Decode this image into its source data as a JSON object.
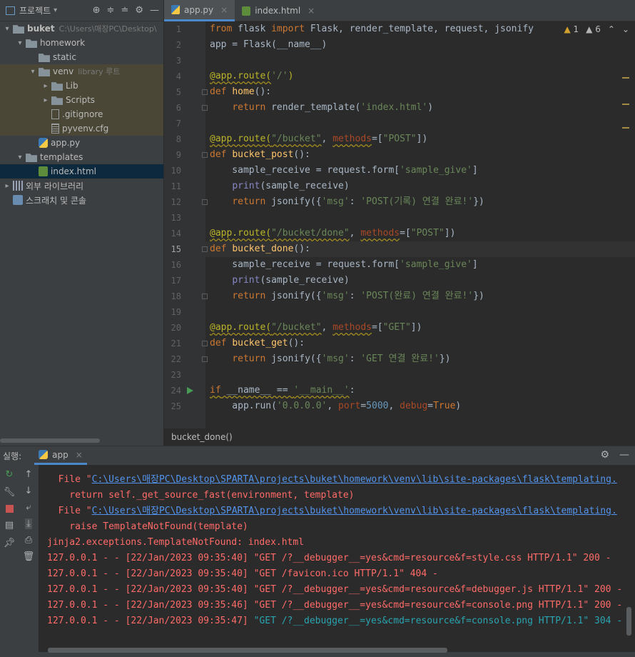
{
  "project": {
    "title": "프로젝트",
    "tree": [
      {
        "label": "buket",
        "sub": "C:\\Users\\매장PC\\Desktop\\",
        "type": "folder",
        "arrow": "▾",
        "level": 0,
        "bold": true
      },
      {
        "label": "homework",
        "sub": "",
        "type": "folder",
        "arrow": "▾",
        "level": 1
      },
      {
        "label": "static",
        "sub": "",
        "type": "folder",
        "arrow": "",
        "level": 2
      },
      {
        "label": "venv",
        "sub": "library 루트",
        "type": "folder",
        "arrow": "▾",
        "level": 2,
        "hl": true
      },
      {
        "label": "Lib",
        "sub": "",
        "type": "folder",
        "arrow": "▸",
        "level": 3,
        "hl": true
      },
      {
        "label": "Scripts",
        "sub": "",
        "type": "folder",
        "arrow": "▸",
        "level": 3,
        "hl": true
      },
      {
        "label": ".gitignore",
        "sub": "",
        "type": "git",
        "arrow": "",
        "level": 3,
        "hl": true
      },
      {
        "label": "pyvenv.cfg",
        "sub": "",
        "type": "txt",
        "arrow": "",
        "level": 3,
        "hl": true
      },
      {
        "label": "app.py",
        "sub": "",
        "type": "py",
        "arrow": "",
        "level": 2
      },
      {
        "label": "templates",
        "sub": "",
        "type": "folder",
        "arrow": "▾",
        "level": 1
      },
      {
        "label": "index.html",
        "sub": "",
        "type": "html",
        "arrow": "",
        "level": 2,
        "sel": true
      },
      {
        "label": "외부 라이브러리",
        "sub": "",
        "type": "lib",
        "arrow": "▸",
        "level": 0
      },
      {
        "label": "스크래치 및 콘솔",
        "sub": "",
        "type": "scratch",
        "arrow": "",
        "level": 0
      }
    ]
  },
  "tabs": [
    {
      "label": "app.py",
      "active": true,
      "icon": "python-file-icon"
    },
    {
      "label": "index.html",
      "active": false,
      "icon": "html-file-icon"
    }
  ],
  "inspections": {
    "warnings": "1",
    "weak_warnings": "6"
  },
  "editor": {
    "current_line": 15,
    "lines": [
      "<span class=\"kw\">from</span> flask <span class=\"kw\">import</span> Flask, render_template, request, jsonify",
      "app = Flask(__name__)",
      "",
      "<span class=\"dec squig\">@app.route(</span><span class=\"str\">'/'</span><span class=\"dec\">)</span>",
      "<span class=\"kw\">def</span> <span class=\"fn\">home</span>():",
      "    <span class=\"kw\">return</span> render_template(<span class=\"str\">'index.html'</span>)",
      "",
      "<span class=\"dec squig\">@app.route(</span><span class=\"str squig\">\"/bucket\"</span>, <span class=\"param squig\">methods</span>=[<span class=\"str\">\"POST\"</span>])",
      "<span class=\"kw\">def</span> <span class=\"fn\">bucket_post</span>():",
      "    sample_receive = request.form[<span class=\"str\">'sample_give'</span>]",
      "    <span class=\"builtin\">print</span>(sample_receive)",
      "    <span class=\"kw\">return</span> jsonify({<span class=\"str\">'msg'</span>: <span class=\"str\">'POST(기록) 연결 완료!'</span>})",
      "",
      "<span class=\"dec squig\">@app.route(</span><span class=\"str squig\">\"/bucket/done\"</span>, <span class=\"param squig\">methods</span>=[<span class=\"str\">\"POST\"</span>])",
      "<span class=\"kw\">def</span> <span class=\"fn\">bucket_done</span>():",
      "    sample_receive = request.form[<span class=\"str\">'sample_give'</span>]",
      "    <span class=\"builtin\">print</span>(sample_receive)",
      "    <span class=\"kw\">return</span> jsonify({<span class=\"str\">'msg'</span>: <span class=\"str\">'POST(완료) 연결 완료!'</span>})",
      "",
      "<span class=\"dec squig\">@app.route(</span><span class=\"str squig\">\"/bucket\"</span>, <span class=\"param squig\">methods</span>=[<span class=\"str\">\"GET\"</span>])",
      "<span class=\"kw\">def</span> <span class=\"fn\">bucket_get</span>():",
      "    <span class=\"kw\">return</span> jsonify({<span class=\"str\">'msg'</span>: <span class=\"str\">'GET 연결 완료!'</span>})",
      "",
      "<span class=\"kw squig\">if</span><span class=\"squig\"> __name__ == </span><span class=\"str squig\">'__main__'</span>:",
      "    app.run(<span class=\"str\">'0.0.0.0'</span>, <span class=\"param\">port</span>=<span class=\"num\">5000</span>, <span class=\"param\">debug</span>=<span class=\"kw\">True</span>)"
    ]
  },
  "breadcrumb": "bucket_done()",
  "run": {
    "label": "실행:",
    "tab": "app",
    "console": [
      {
        "cls": "",
        "html": "  File \"<span class=\"link\">C:\\Users\\매장PC\\Desktop\\SPARTA\\projects\\buket\\homework\\venv\\lib\\site-packages\\flask\\templating.</span>"
      },
      {
        "cls": "",
        "html": "    return self._get_source_fast(environment, template)"
      },
      {
        "cls": "",
        "html": "  File \"<span class=\"link\">C:\\Users\\매장PC\\Desktop\\SPARTA\\projects\\buket\\homework\\venv\\lib\\site-packages\\flask\\templating.</span>"
      },
      {
        "cls": "",
        "html": "    raise TemplateNotFound(template)"
      },
      {
        "cls": "",
        "html": "jinja2.exceptions.TemplateNotFound: index.html"
      },
      {
        "cls": "",
        "html": "127.0.0.1 - - [22/Jan/2023 09:35:40] \"GET /?__debugger__=yes&amp;cmd=resource&amp;f=style.css HTTP/1.1\" 200 -"
      },
      {
        "cls": "",
        "html": "127.0.0.1 - - [22/Jan/2023 09:35:40] \"GET /favicon.ico HTTP/1.1\" 404 -"
      },
      {
        "cls": "",
        "html": "127.0.0.1 - - [22/Jan/2023 09:35:40] \"GET /?__debugger__=yes&amp;cmd=resource&amp;f=debugger.js HTTP/1.1\" 200 -"
      },
      {
        "cls": "",
        "html": "127.0.0.1 - - [22/Jan/2023 09:35:46] \"GET /?__debugger__=yes&amp;cmd=resource&amp;f=console.png HTTP/1.1\" 200 -"
      },
      {
        "cls": "",
        "html": "127.0.0.1 - - [22/Jan/2023 09:35:47] <span class=\"cyan\">\"GET /?__debugger__=yes&amp;cmd=resource&amp;f=console.png HTTP/1.1\" 304 -</span>"
      }
    ]
  }
}
